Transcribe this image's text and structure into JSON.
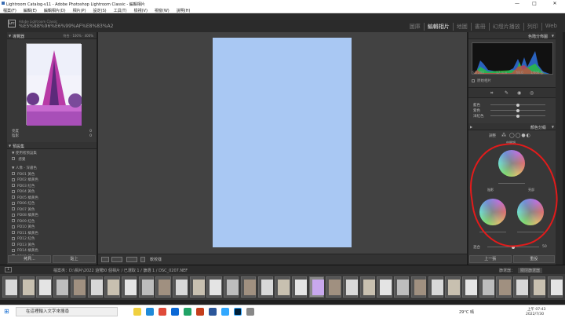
{
  "window": {
    "title": "Lightroom Catalog-v11 - Adobe Photoshop Lightroom Classic - 編輯相片",
    "minimize": "—",
    "maximize": "□",
    "close": "✕"
  },
  "menu": [
    "檔案(F)",
    "編輯(E)",
    "編輯相片(D)",
    "相片(P)",
    "設定(S)",
    "工具(T)",
    "檢視(V)",
    "視窗(W)",
    "說明(H)"
  ],
  "identity": {
    "logo": "Lrc",
    "brand": "Adobe Lightroom Classic",
    "path": "%E5%8B%96%E6%99%AF%E8%83%A2"
  },
  "modules": [
    {
      "label": "圖庫",
      "active": false
    },
    {
      "label": "編輯相片",
      "active": true
    },
    {
      "label": "地圖",
      "active": false
    },
    {
      "label": "書冊",
      "active": false
    },
    {
      "label": "幻燈片播放",
      "active": false
    },
    {
      "label": "列印",
      "active": false
    },
    {
      "label": "Web",
      "active": false
    }
  ],
  "left": {
    "navigator": {
      "title": "導覽器",
      "zoom": "符合 · 100% · 400%"
    },
    "info_rows": [
      {
        "label": "亮度",
        "value": "0"
      },
      {
        "label": "陰影",
        "value": "0"
      }
    ],
    "presets": {
      "title": "預設集",
      "items": [
        "▼ 使用者預設集",
        "  感覺",
        "▼ 人像 - 深膚色",
        "PD01 黃色",
        "PD02 橘黃色",
        "PD03 紅色",
        "PD04 黃色",
        "PD05 橘黃色",
        "PD06 紅色",
        "PD07 黃色",
        "PD08 橘黃色",
        "PD09 紅色",
        "PD10 黃色",
        "PD11 橘黃色",
        "PD12 紅色",
        "PD13 黃色",
        "PD14 橘黃色",
        "PD15 紅色"
      ]
    },
    "buttons": {
      "copy": "拷貝...",
      "paste": "貼上"
    }
  },
  "toolbar": {
    "soft_proof": "軟校樣"
  },
  "right": {
    "histogram": {
      "title": "色階分佈圖",
      "iso": "ISO 200",
      "focal": "17 mm",
      "aperture": "f/8.0",
      "shutter": "1/400 秒",
      "original": "原始相片"
    },
    "tone_rows": [
      {
        "label": "藍色",
        "value": ""
      },
      {
        "label": "紫色",
        "value": ""
      },
      {
        "label": "洋紅色",
        "value": ""
      }
    ],
    "color_grading": {
      "title": "顏色分級",
      "adjust": "調整",
      "midtones": "中間調",
      "shadows": "陰影",
      "highlights": "亮部",
      "blending": "混合",
      "blending_value": "50",
      "balance": "平衡"
    },
    "buttons": {
      "prev": "上一張",
      "reset": "重設"
    }
  },
  "filmstrip_bar": {
    "source": "1",
    "folder": "檔案夾：D:\\相片\\2022 遊覽",
    "count": "30 個相片 / 已選取 1 / 篩選 1 / DSC_0207.NEF",
    "filter_label": "篩選器：",
    "filter_value": "關閉篩選器"
  },
  "filmstrip": {
    "count": 33,
    "selected_index": 18
  },
  "taskbar": {
    "search_placeholder": "在這裡輸入文字來搜尋",
    "weather": "29°C 晴",
    "time": "上午 07:43",
    "date": "2022/7/30"
  },
  "colors": {
    "annotation": "#e21b1b",
    "photo": "#a9c8f3"
  }
}
